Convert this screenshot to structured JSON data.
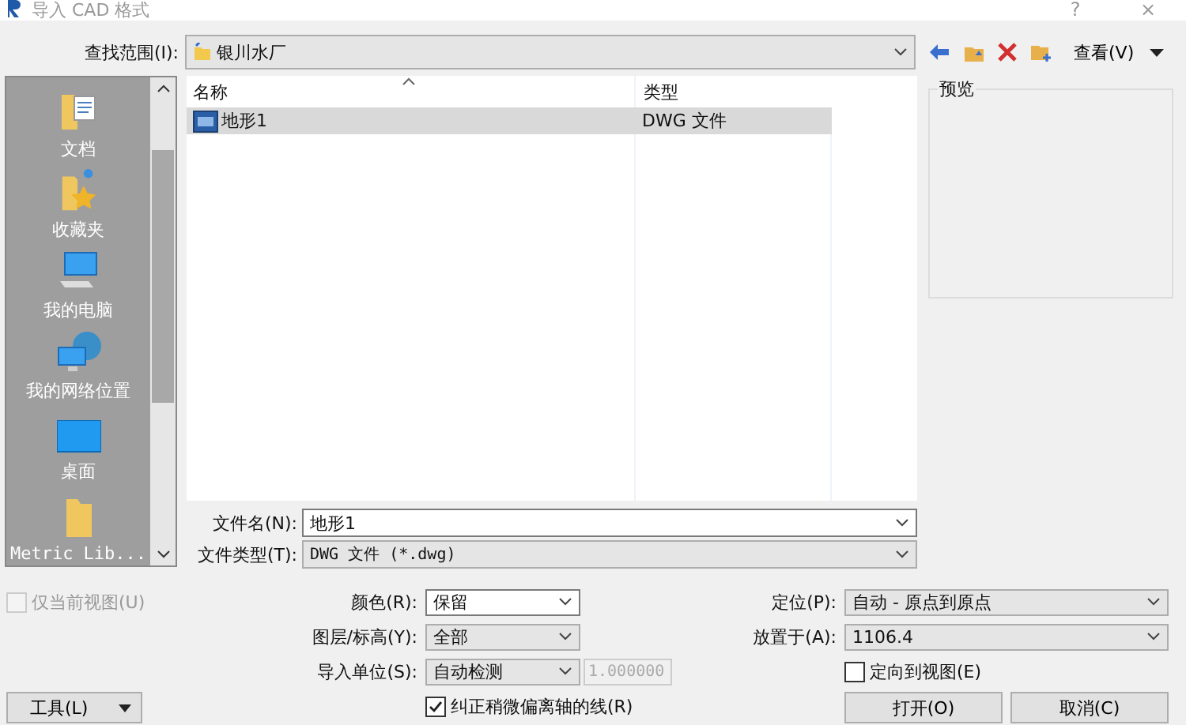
{
  "window": {
    "title": "导入 CAD 格式",
    "buttons": [
      "?",
      "×"
    ]
  },
  "look_in": {
    "label": "查找范围(I):",
    "value": "银川水厂"
  },
  "toolbar": {
    "view_menu": "查看(V)"
  },
  "places": [
    {
      "label": "文档",
      "kind": "documents"
    },
    {
      "label": "收藏夹",
      "kind": "favorites"
    },
    {
      "label": "我的电脑",
      "kind": "computer"
    },
    {
      "label": "我的网络位置",
      "kind": "network"
    },
    {
      "label": "桌面",
      "kind": "desktop"
    },
    {
      "label": "Metric Lib...",
      "kind": "folder"
    }
  ],
  "file_list": {
    "columns": [
      "名称",
      "类型"
    ],
    "rows": [
      {
        "name": "地形1",
        "type": "DWG 文件",
        "selected": true
      }
    ]
  },
  "preview": {
    "label": "预览"
  },
  "file_name": {
    "label": "文件名(N):",
    "value": "地形1"
  },
  "file_type": {
    "label": "文件类型(T):",
    "value": "DWG 文件 (*.dwg)"
  },
  "current_view_only": {
    "label": "仅当前视图(U)",
    "checked": false,
    "disabled": true
  },
  "colors": {
    "label": "颜色(R):",
    "value": "保留",
    "kind": "editable"
  },
  "layers": {
    "label": "图层/标高(Y):",
    "value": "全部",
    "kind": "list"
  },
  "import_units": {
    "label": "导入单位(S):",
    "value": "自动检测",
    "kind": "list",
    "scale": "1.000000",
    "scale_disabled": true
  },
  "correct_lines": {
    "label": "纠正稍微偏离轴的线(R)",
    "checked": true,
    "disabled": false
  },
  "positioning": {
    "label": "定位(P):",
    "value": "自动 - 原点到原点",
    "kind": "list"
  },
  "place_at": {
    "label": "放置于(A):",
    "value": "1106.4",
    "kind": "list"
  },
  "orient_to_view": {
    "label": "定向到视图(E)",
    "checked": false,
    "disabled": false
  },
  "tools_button": "工具(L)",
  "buttons": [
    "打开(O)",
    "取消(C)"
  ]
}
